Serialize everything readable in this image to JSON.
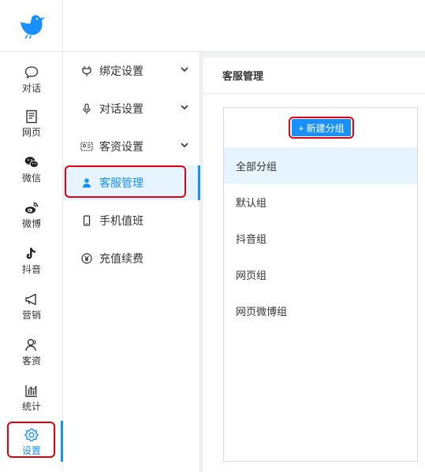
{
  "brand": {
    "accent": "#1890ff",
    "highlight": "#e0000f"
  },
  "rail": {
    "items": [
      {
        "label": "对话",
        "icon": "chat-bubble-icon"
      },
      {
        "label": "网页",
        "icon": "webpage-icon"
      },
      {
        "label": "微信",
        "icon": "wechat-icon"
      },
      {
        "label": "微博",
        "icon": "weibo-icon"
      },
      {
        "label": "抖音",
        "icon": "douyin-icon"
      },
      {
        "label": "营销",
        "icon": "megaphone-icon"
      },
      {
        "label": "客资",
        "icon": "customers-icon"
      },
      {
        "label": "统计",
        "icon": "bar-chart-icon"
      },
      {
        "label": "设置",
        "icon": "gear-icon"
      }
    ],
    "active": "设置"
  },
  "submenu": {
    "items": [
      {
        "label": "绑定设置",
        "icon": "plug-icon",
        "expandable": true
      },
      {
        "label": "对话设置",
        "icon": "microphone-icon",
        "expandable": true
      },
      {
        "label": "客资设置",
        "icon": "id-card-icon",
        "expandable": true
      },
      {
        "label": "客服管理",
        "icon": "user-icon",
        "expandable": false
      },
      {
        "label": "手机值班",
        "icon": "mobile-icon",
        "expandable": false
      },
      {
        "label": "充值续费",
        "icon": "yen-icon",
        "expandable": false
      }
    ],
    "active": "客服管理"
  },
  "main": {
    "title": "客服管理",
    "new_group_button": "+ 新建分组",
    "groups": [
      "全部分组",
      "默认组",
      "抖音组",
      "网页组",
      "网页微博组"
    ],
    "active_group": "全部分组"
  }
}
